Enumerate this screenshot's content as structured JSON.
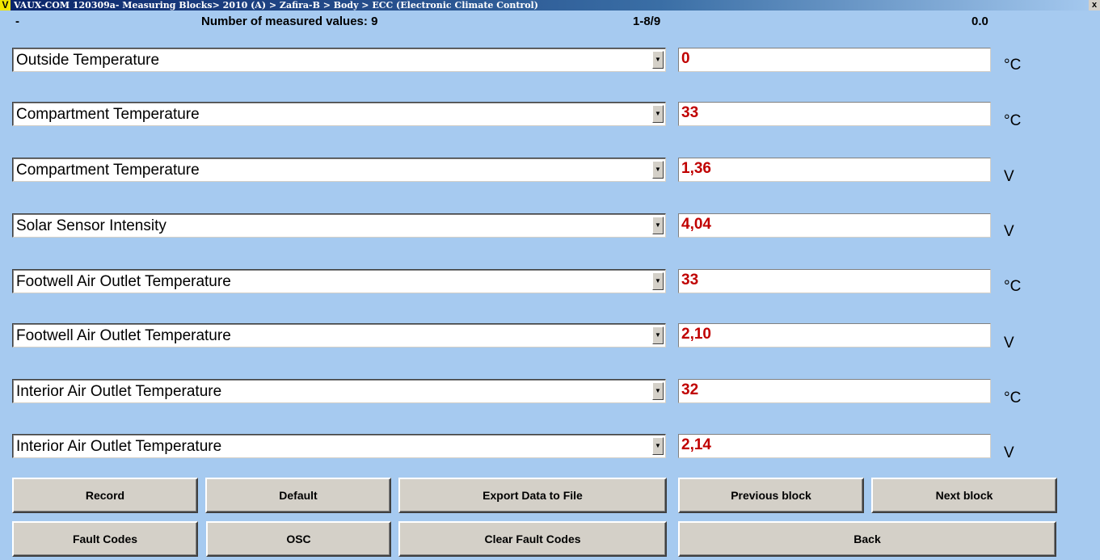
{
  "window": {
    "logo": "V",
    "title": "VAUX-COM 120309a- Measuring Blocks> 2010 (A) > Zafira-B > Body > ECC (Electronic Climate Control)",
    "close": "x"
  },
  "header": {
    "dash": "-",
    "count_label": "Number of measured values: 9",
    "range": "1-8/9",
    "value": "0.0"
  },
  "rows": [
    {
      "label": "Outside Temperature",
      "value": "0",
      "unit": "°C"
    },
    {
      "label": "Compartment Temperature",
      "value": "33",
      "unit": "°C"
    },
    {
      "label": "Compartment Temperature",
      "value": "1,36",
      "unit": "V"
    },
    {
      "label": "Solar Sensor Intensity",
      "value": "4,04",
      "unit": "V"
    },
    {
      "label": "Footwell Air Outlet Temperature",
      "value": "33",
      "unit": "°C"
    },
    {
      "label": "Footwell Air Outlet Temperature",
      "value": "2,10",
      "unit": "V"
    },
    {
      "label": "Interior Air Outlet Temperature",
      "value": "32",
      "unit": "°C"
    },
    {
      "label": "Interior Air Outlet Temperature",
      "value": "2,14",
      "unit": "V"
    }
  ],
  "buttons": {
    "record": "Record",
    "default": "Default",
    "export": "Export Data to File",
    "previous": "Previous block",
    "next": "Next block",
    "fault_codes": "Fault Codes",
    "osc": "OSC",
    "clear_fault_codes": "Clear Fault Codes",
    "back": "Back"
  },
  "colors": {
    "background": "#a6caf0",
    "value_text": "#c00000",
    "button_face": "#d4d0c8"
  }
}
